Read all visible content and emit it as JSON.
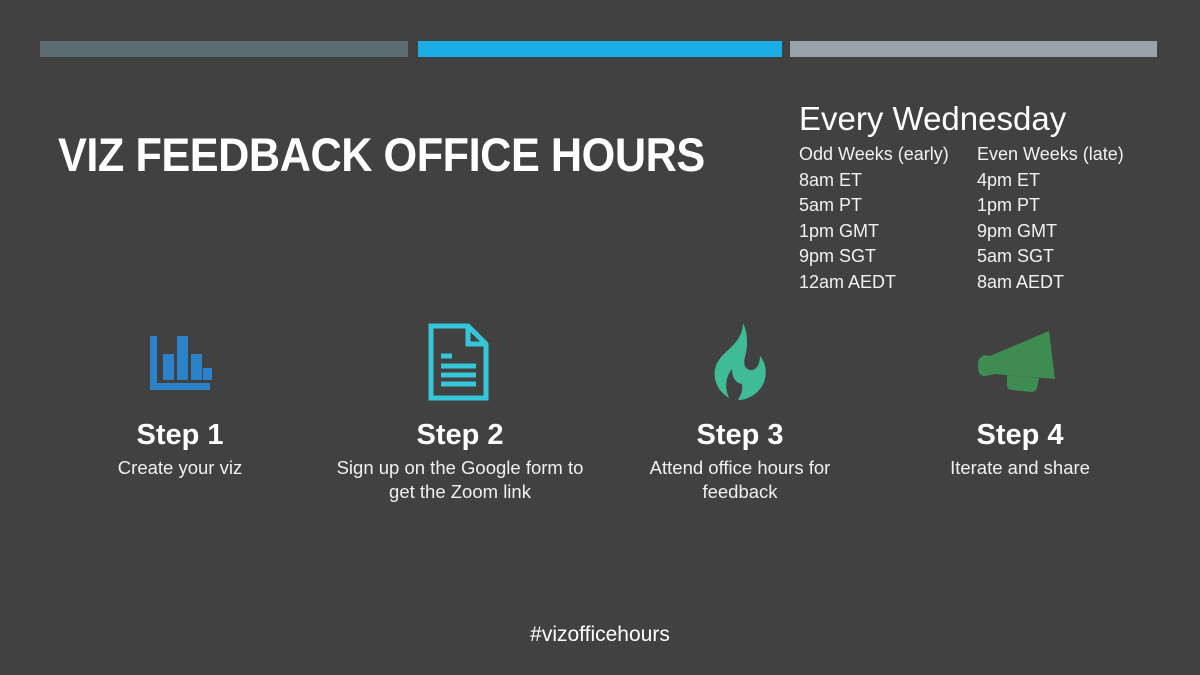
{
  "slide": {
    "background_color": "#414141",
    "title": "VIZ FEEDBACK OFFICE HOURS",
    "hashtag": "#vizofficehours"
  },
  "accent_bars": [
    {
      "name": "slate-bar",
      "color": "#5c6b72"
    },
    {
      "name": "cyan-bar",
      "color": "#1aaee5"
    },
    {
      "name": "gray-bar",
      "color": "#9aa2ab"
    }
  ],
  "schedule": {
    "title": "Every Wednesday",
    "columns": [
      {
        "heading": "Odd Weeks (early)",
        "times": [
          "8am ET",
          "5am PT",
          "1pm GMT",
          "9pm SGT",
          "12am AEDT"
        ]
      },
      {
        "heading": "Even Weeks (late)",
        "times": [
          "4pm ET",
          "1pm PT",
          "9pm GMT",
          "5am SGT",
          "8am AEDT"
        ]
      }
    ]
  },
  "steps": [
    {
      "icon": "bar-chart-icon",
      "icon_color": "#2b82c8",
      "title": "Step 1",
      "caption": "Create your viz"
    },
    {
      "icon": "document-icon",
      "icon_color": "#35c6d8",
      "title": "Step 2",
      "caption": "Sign up on the Google form to get the Zoom link"
    },
    {
      "icon": "flame-icon",
      "icon_color": "#3fbb96",
      "title": "Step 3",
      "caption": "Attend office hours for feedback"
    },
    {
      "icon": "megaphone-icon",
      "icon_color": "#3f8c52",
      "title": "Step 4",
      "caption": "Iterate and share"
    }
  ]
}
